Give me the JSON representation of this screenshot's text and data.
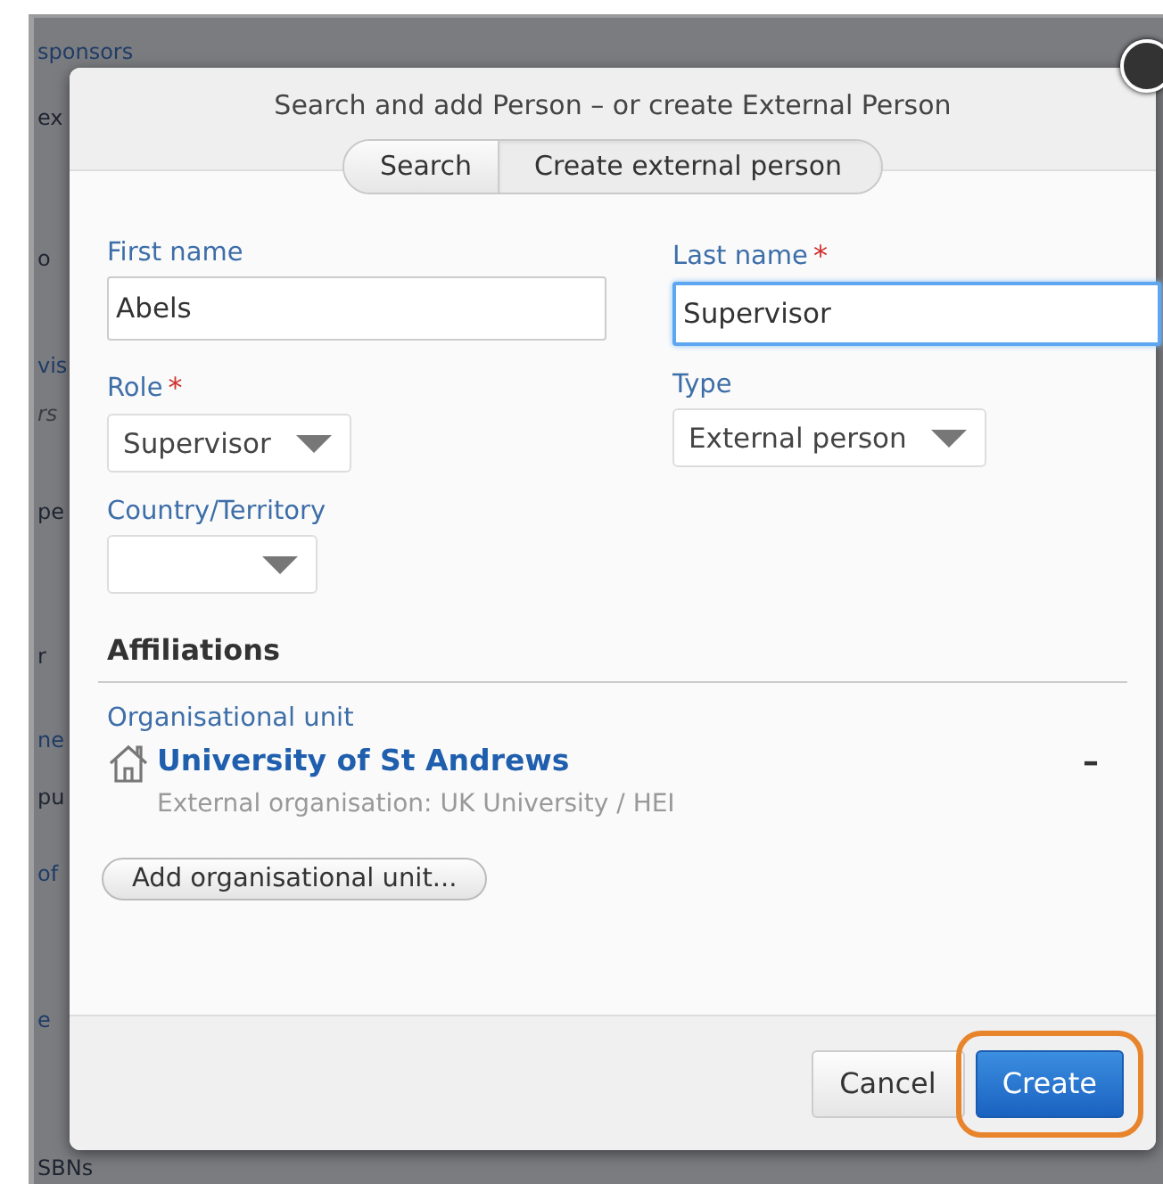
{
  "background_fragments": [
    {
      "text": "sponsors",
      "kind": "link"
    },
    {
      "text": "ex",
      "kind": "plain"
    },
    {
      "text": "o",
      "kind": "plain"
    },
    {
      "text": "vis",
      "kind": "link"
    },
    {
      "text": "rs",
      "kind": "italic"
    },
    {
      "text": "pe",
      "kind": "plain"
    },
    {
      "text": "r",
      "kind": "plain"
    },
    {
      "text": "ne",
      "kind": "link"
    },
    {
      "text": "pu",
      "kind": "plain"
    },
    {
      "text": "of",
      "kind": "link"
    },
    {
      "text": "e",
      "kind": "link"
    },
    {
      "text": "SBNs",
      "kind": "plain"
    }
  ],
  "dialog": {
    "title": "Search and add Person – or create External Person",
    "tabs": [
      {
        "label": "Search",
        "selected": false
      },
      {
        "label": "Create external person",
        "selected": true
      }
    ],
    "fields": [
      {
        "kind": "text",
        "label": "First name",
        "required": false,
        "value": "Abels",
        "focused": false
      },
      {
        "kind": "text",
        "label": "Last name",
        "required": true,
        "value": "Supervisor",
        "focused": true
      },
      {
        "kind": "select",
        "label": "Role",
        "required": true,
        "value": "Supervisor"
      },
      {
        "kind": "select",
        "label": "Type",
        "required": false,
        "value": "External person"
      },
      {
        "kind": "select",
        "label": "Country/Territory",
        "required": false
      }
    ],
    "required_mark": "*",
    "affiliations": {
      "heading": "Affiliations",
      "label": "Organisational unit",
      "units": [
        {
          "name": "University of St Andrews",
          "detail": "External organisation: UK University / HEI",
          "remove": "–"
        }
      ],
      "add_button": "Add organisational unit..."
    },
    "buttons": [
      {
        "label": "Cancel",
        "kind": "secondary",
        "highlighted": false
      },
      {
        "label": "Create",
        "kind": "primary",
        "highlighted": true
      }
    ]
  }
}
